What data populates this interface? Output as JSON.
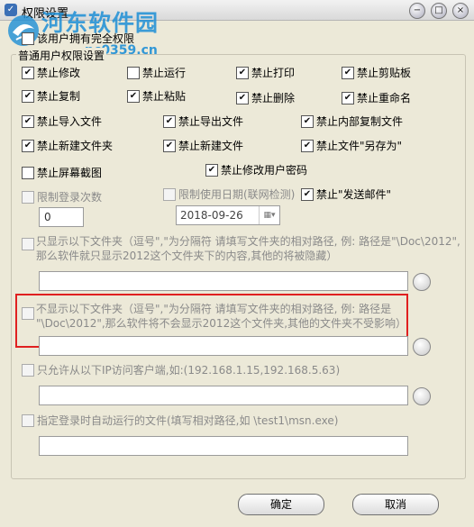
{
  "window": {
    "title": "权限设置",
    "minimize": "−",
    "maximize": "□",
    "close": "×"
  },
  "watermark": {
    "site_name": "河东软件园",
    "site_url": "pc0359.cn"
  },
  "full_permission": {
    "label": "该用户拥有完全权限",
    "checked": false
  },
  "group": {
    "label": "普通用户权限设置"
  },
  "checkboxes": [
    {
      "label": "禁止修改",
      "checked": true
    },
    {
      "label": "禁止运行",
      "checked": false
    },
    {
      "label": "禁止打印",
      "checked": true
    },
    {
      "label": "禁止剪贴板",
      "checked": true
    },
    {
      "label": "禁止复制",
      "checked": true
    },
    {
      "label": "禁止粘贴",
      "checked": true
    },
    {
      "label": "禁止删除",
      "checked": true
    },
    {
      "label": "禁止重命名",
      "checked": true
    },
    {
      "label": "禁止导入文件",
      "checked": true
    },
    {
      "label": "禁止导出文件",
      "checked": true
    },
    {
      "label": "禁止内部复制文件",
      "checked": true
    },
    {
      "label": "禁止新建文件夹",
      "checked": true
    },
    {
      "label": "禁止新建文件",
      "checked": true
    },
    {
      "label": "禁止文件\"另存为\"",
      "checked": true
    },
    {
      "label": "禁止屏幕截图",
      "checked": false
    },
    {
      "label": "禁止修改用户密码",
      "checked": true
    }
  ],
  "limit_login": {
    "label": "限制登录次数",
    "checked": false,
    "value": "0"
  },
  "limit_date": {
    "label": "限制使用日期(联网检测)",
    "checked": false,
    "value": "2018-09-26"
  },
  "forbid_email": {
    "label": "禁止\"发送邮件\"",
    "checked": true
  },
  "show_folders": {
    "text1": "只显示以下文件夹（逗号\",\"为分隔符 请填写文件夹的相对路径, 例: 路径是\"\\Doc\\2012\",",
    "text2": "那么软件就只显示2012这个文件夹下的内容,其他的将被隐藏）",
    "checked": false,
    "value": ""
  },
  "hide_folders": {
    "text1": "不显示以下文件夹（逗号\",\"为分隔符 请填写文件夹的相对路径, 例: 路径是",
    "text2": "\"\\Doc\\2012\",那么软件将不会显示2012这个文件夹,其他的文件夹不受影响）",
    "checked": false,
    "value": ""
  },
  "allow_ip": {
    "label": "只允许从以下IP访问客户端,如:(192.168.1.15,192.168.5.63)",
    "checked": false,
    "value": ""
  },
  "auto_run": {
    "label": "指定登录时自动运行的文件(填写相对路径,如 \\test1\\msn.exe)",
    "checked": false,
    "value": ""
  },
  "buttons": {
    "ok": "确定",
    "cancel": "取消"
  },
  "colors": {
    "highlight_box": "#e02020",
    "watermark": "#1e8fd6"
  }
}
